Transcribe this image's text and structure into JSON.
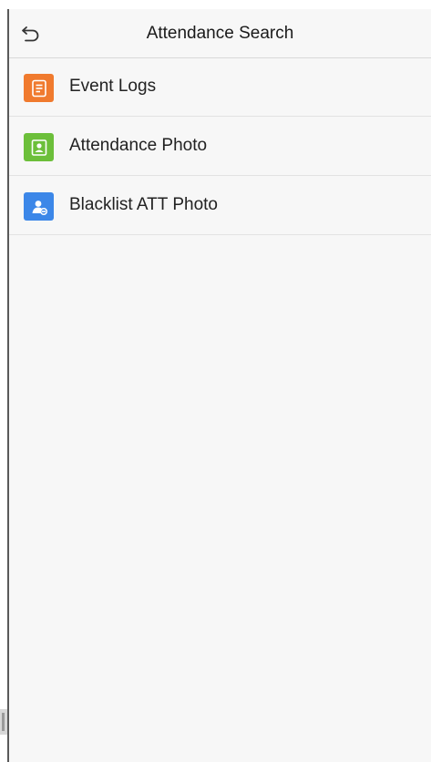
{
  "header": {
    "back_icon": "back-arrow-icon",
    "title": "Attendance Search"
  },
  "menu": {
    "items": [
      {
        "label": "Event Logs",
        "icon": "document-list-icon",
        "icon_color": "#f07a2e"
      },
      {
        "label": "Attendance Photo",
        "icon": "photo-portrait-icon",
        "icon_color": "#6cbf3a"
      },
      {
        "label": "Blacklist ATT Photo",
        "icon": "blocked-user-icon",
        "icon_color": "#3c87e8"
      }
    ]
  },
  "colors": {
    "screen_background": "#f7f7f7",
    "divider": "#e2e2e2",
    "text": "#222222"
  }
}
